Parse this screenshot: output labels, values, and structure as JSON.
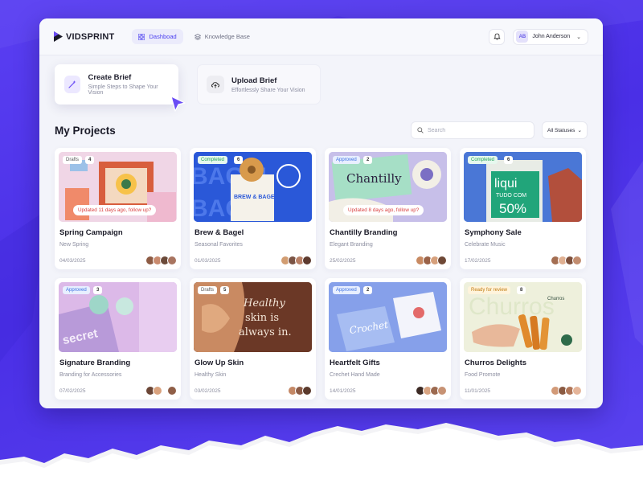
{
  "brand": {
    "name": "VIDSPRINT"
  },
  "nav": [
    {
      "label": "Dashboad",
      "icon": "grid-icon",
      "active": true
    },
    {
      "label": "Knowledge Base",
      "icon": "stack-icon",
      "active": false
    }
  ],
  "user": {
    "initials": "AB",
    "name": "John Anderson"
  },
  "actions": {
    "create": {
      "title": "Create Brief",
      "subtitle": "Simple Steps to Shape Your Vision"
    },
    "upload": {
      "title": "Upload Brief",
      "subtitle": "Effortlessly Share Your Vision"
    }
  },
  "projects": {
    "title": "My Projects",
    "search_placeholder": "Search",
    "status_filter": "All Statuses",
    "cards": [
      {
        "title": "Spring Campaign",
        "subtitle": "New Spring",
        "date": "04/03/2025",
        "status": "Drafts",
        "count": "4",
        "followup": "Updated 11 days ago, follow up?"
      },
      {
        "title": "Brew & Bagel",
        "subtitle": "Seasonal Favorites",
        "date": "01/03/2025",
        "status": "Completed",
        "count": "6",
        "followup": ""
      },
      {
        "title": "Chantilly Branding",
        "subtitle": "Elegant Branding",
        "date": "25/02/2025",
        "status": "Approved",
        "count": "2",
        "followup": "Updated 8 days ago, follow up?"
      },
      {
        "title": "Symphony Sale",
        "subtitle": "Celebrate Music",
        "date": "17/02/2025",
        "status": "Completed",
        "count": "6",
        "followup": ""
      },
      {
        "title": "Signature Branding",
        "subtitle": "Branding for Accessories",
        "date": "07/02/2025",
        "status": "Approved",
        "count": "3",
        "followup": ""
      },
      {
        "title": "Glow Up Skin",
        "subtitle": "Healthy Skin",
        "date": "03/02/2025",
        "status": "Drafts",
        "count": "5",
        "followup": ""
      },
      {
        "title": "Heartfelt Gifts",
        "subtitle": "Crechet Hand Made",
        "date": "14/01/2025",
        "status": "Approved",
        "count": "2",
        "followup": ""
      },
      {
        "title": "Churros Delights",
        "subtitle": "Food Promote",
        "date": "11/01/2025",
        "status": "Ready for review",
        "count": "8",
        "followup": ""
      }
    ]
  },
  "thumb_text": {
    "bagel_big": "BAGEL",
    "bagel_bag": "BREW & BAGEL",
    "chantilly": "Chantilly",
    "liqui": "liqui",
    "tudo": "TUDO COM",
    "pct": "50%",
    "secret": "secret",
    "glow1": "Healthy",
    "glow2": "skin is",
    "glow3": "always in.",
    "crochet": "Crochet",
    "churros": "Churros"
  },
  "colors": {
    "accent": "#4b3ff0",
    "background": "#5a3ff2",
    "completed": "#26a35a",
    "approved": "#3b6fe0",
    "followup": "#d94040"
  }
}
